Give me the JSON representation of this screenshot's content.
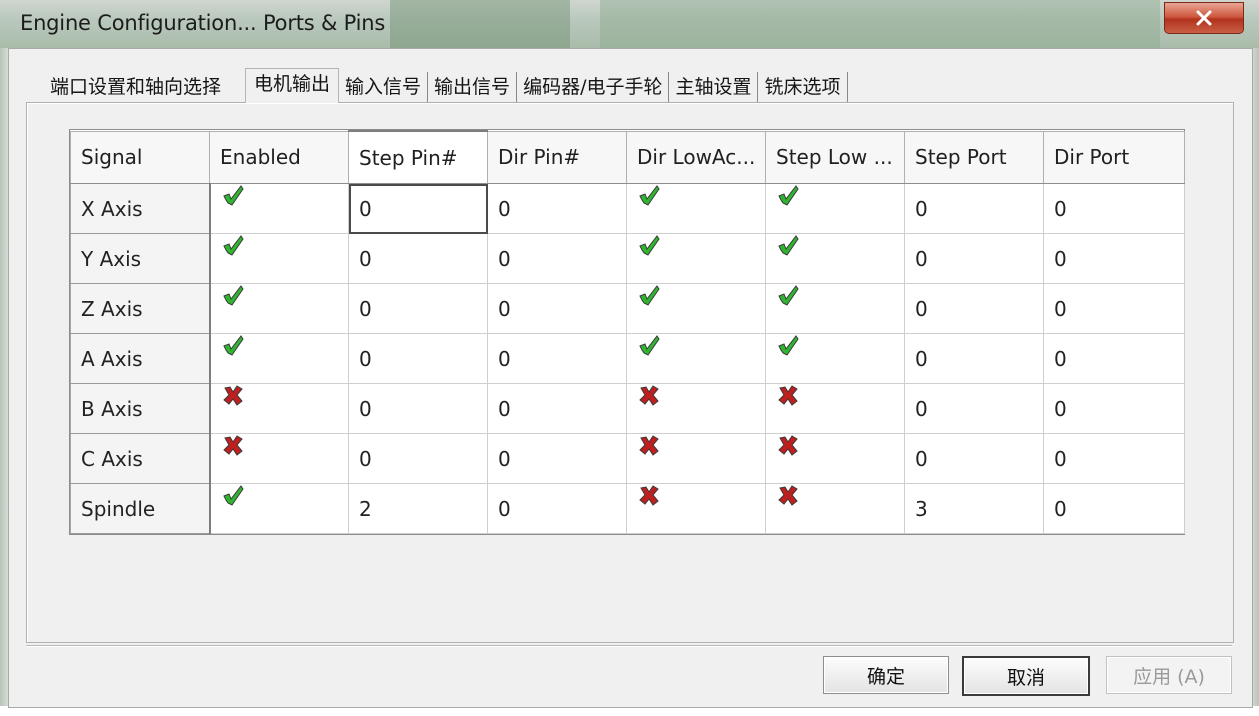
{
  "window": {
    "title": "Engine Configuration... Ports & Pins"
  },
  "tabs": [
    {
      "label": "端口设置和轴向选择",
      "active": false
    },
    {
      "label": "电机输出",
      "active": true
    },
    {
      "label": "输入信号",
      "active": false
    },
    {
      "label": "输出信号",
      "active": false
    },
    {
      "label": "编码器/电子手轮",
      "active": false
    },
    {
      "label": "主轴设置",
      "active": false
    },
    {
      "label": "铣床选项",
      "active": false
    }
  ],
  "grid": {
    "columns": [
      "Signal",
      "Enabled",
      "Step Pin#",
      "Dir Pin#",
      "Dir LowAc...",
      "Step Low ...",
      "Step Port",
      "Dir Port"
    ],
    "rows": [
      {
        "signal": "X Axis",
        "enabled": "check",
        "step_pin": "0",
        "dir_pin": "0",
        "dir_low": "check",
        "step_low": "check",
        "step_port": "0",
        "dir_port": "0"
      },
      {
        "signal": "Y Axis",
        "enabled": "check",
        "step_pin": "0",
        "dir_pin": "0",
        "dir_low": "check",
        "step_low": "check",
        "step_port": "0",
        "dir_port": "0"
      },
      {
        "signal": "Z Axis",
        "enabled": "check",
        "step_pin": "0",
        "dir_pin": "0",
        "dir_low": "check",
        "step_low": "check",
        "step_port": "0",
        "dir_port": "0"
      },
      {
        "signal": "A Axis",
        "enabled": "check",
        "step_pin": "0",
        "dir_pin": "0",
        "dir_low": "check",
        "step_low": "check",
        "step_port": "0",
        "dir_port": "0"
      },
      {
        "signal": "B Axis",
        "enabled": "cross",
        "step_pin": "0",
        "dir_pin": "0",
        "dir_low": "cross",
        "step_low": "cross",
        "step_port": "0",
        "dir_port": "0"
      },
      {
        "signal": "C Axis",
        "enabled": "cross",
        "step_pin": "0",
        "dir_pin": "0",
        "dir_low": "cross",
        "step_low": "cross",
        "step_port": "0",
        "dir_port": "0"
      },
      {
        "signal": "Spindle",
        "enabled": "check",
        "step_pin": "2",
        "dir_pin": "0",
        "dir_low": "cross",
        "step_low": "cross",
        "step_port": "3",
        "dir_port": "0"
      }
    ]
  },
  "buttons": {
    "ok": "确定",
    "cancel": "取消",
    "apply": "应用 (A)"
  },
  "colors": {
    "check_green": "#2fb52f",
    "cross_red": "#c01f1f"
  }
}
